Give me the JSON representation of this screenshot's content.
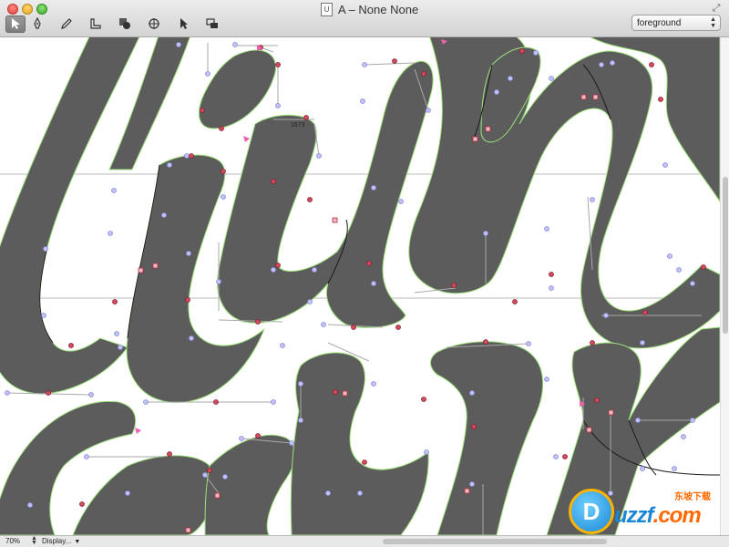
{
  "window": {
    "title": "A – None None",
    "doc_icon": "U"
  },
  "toolbar": {
    "tools": [
      {
        "name": "select-tool",
        "icon": "arrow-icon"
      },
      {
        "name": "pen-tool",
        "icon": "pen-icon"
      },
      {
        "name": "pencil-tool",
        "icon": "pencil-icon"
      },
      {
        "name": "measure-tool",
        "icon": "ruler-icon"
      },
      {
        "name": "shapes-tool",
        "icon": "shapes-icon"
      },
      {
        "name": "component-tool",
        "icon": "compass-icon"
      },
      {
        "name": "node-tool",
        "icon": "node-arrow-icon"
      },
      {
        "name": "layers-tool",
        "icon": "layers-icon"
      }
    ]
  },
  "layer_select": {
    "value": "foreground"
  },
  "canvas": {
    "point_label": "1673",
    "colors": {
      "glyph_fill": "#5c5c5c",
      "outline_green": "#9be27a",
      "handle_blue": "#a7a7f2",
      "node_red": "#c72e48",
      "pink": "#ee5fb0"
    }
  },
  "status": {
    "zoom": "70%",
    "display_menu": "Display..."
  },
  "watermark": {
    "brand": "uzzf",
    "domain": ".com",
    "cn": "东坡下载",
    "logo_letter": "D"
  }
}
